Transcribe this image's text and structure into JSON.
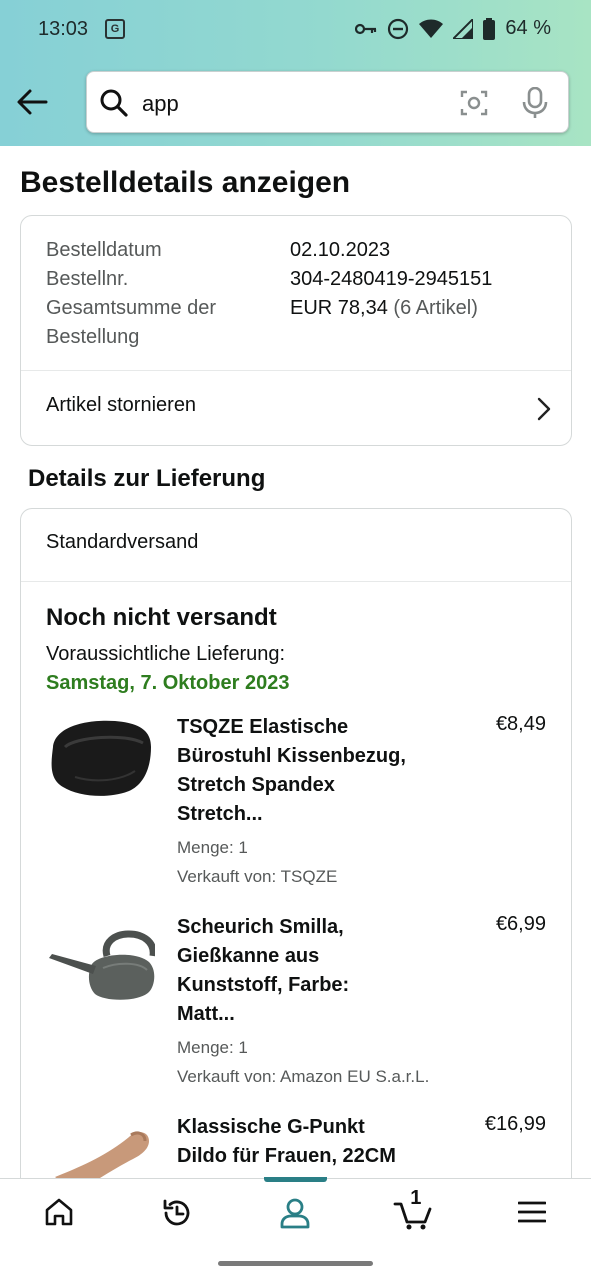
{
  "status_bar": {
    "time": "13:03",
    "battery": "64 %",
    "icons": [
      "translate-icon",
      "vpn-key-icon",
      "dnd-icon",
      "wifi-icon",
      "signal-icon",
      "battery-icon"
    ]
  },
  "search": {
    "query": "app",
    "icons": [
      "back-arrow-icon",
      "search-icon",
      "camera-icon",
      "mic-icon"
    ]
  },
  "page_title": "Bestelldetails anzeigen",
  "order": {
    "date_label": "Bestelldatum",
    "date_value": "02.10.2023",
    "number_label": "Bestellnr.",
    "number_value": "304-2480419-2945151",
    "total_label_line1": "Gesamtsumme der",
    "total_label_line2": "Bestellung",
    "total_value": "EUR 78,34",
    "total_count": "(6 Artikel)",
    "cancel_label": "Artikel stornieren"
  },
  "delivery": {
    "heading": "Details zur Lieferung",
    "method": "Standardversand",
    "status": "Noch nicht versandt",
    "eta_label": "Voraussichtliche Lieferung:",
    "eta_date": "Samstag, 7. Oktober 2023"
  },
  "items": [
    {
      "title_lines": [
        "TSQZE Elastische",
        "Bürostuhl Kissenbezug,",
        "Stretch Spandex",
        "Stretch..."
      ],
      "price": "€8,49",
      "quantity": "Menge: 1",
      "seller": "Verkauft von: TSQZE",
      "image": "black-seat-cushion-cover"
    },
    {
      "title_lines": [
        "Scheurich Smilla,",
        "Gießkanne aus",
        "Kunststoff, Farbe:",
        "Matt..."
      ],
      "price": "€6,99",
      "quantity": "Menge: 1",
      "seller": "Verkauft von: Amazon EU S.a.r.L.",
      "image": "grey-watering-can"
    },
    {
      "title_lines": [
        "Klassische G-Punkt",
        "Dildo für Frauen, 22CM"
      ],
      "price": "€16,99",
      "image": "flesh-toned-product"
    }
  ],
  "bottom_nav": {
    "cart_count": "1",
    "icons": [
      "home-icon",
      "refresh-icon",
      "account-icon",
      "cart-icon",
      "menu-icon"
    ],
    "active": "account-icon"
  },
  "colors": {
    "header_gradient_start": "#86d0d6",
    "header_gradient_end": "#a8e4c4",
    "eta_green": "#2e7d1f",
    "active_nav": "#2a7f86"
  }
}
